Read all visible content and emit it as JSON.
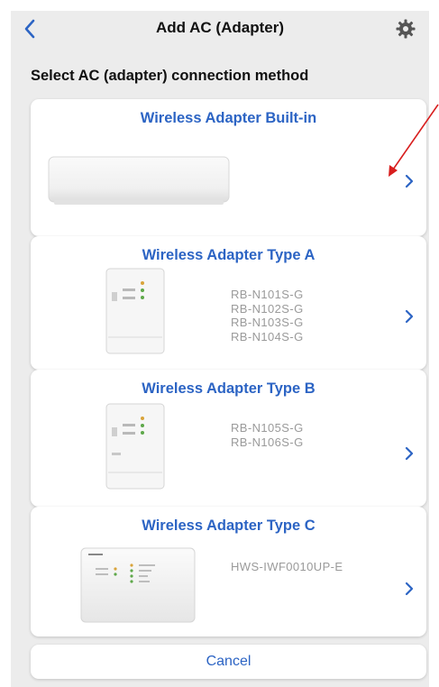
{
  "colors": {
    "accent": "#2c64c4",
    "background": "#ececec",
    "card": "#ffffff",
    "model_text": "#9a9a9a",
    "annotation_arrow": "#d81e1e"
  },
  "navbar": {
    "back_icon": "chevron-left-icon",
    "title": "Add AC (Adapter)",
    "settings_icon": "gear-icon"
  },
  "main": {
    "subtitle": "Select AC (adapter) connection method",
    "options": [
      {
        "title": "Wireless Adapter Built-in",
        "models": [],
        "image": "ac-indoor-unit"
      },
      {
        "title": "Wireless Adapter Type A",
        "models": [
          "RB-N101S-G",
          "RB-N102S-G",
          "RB-N103S-G",
          "RB-N104S-G"
        ],
        "image": "adapter-device"
      },
      {
        "title": "Wireless Adapter Type B",
        "models": [
          "RB-N105S-G",
          "RB-N106S-G"
        ],
        "image": "adapter-device"
      },
      {
        "title": "Wireless Adapter Type C",
        "models": [
          "HWS-IWF0010UP-E"
        ],
        "image": "adapter-box"
      }
    ],
    "cancel_label": "Cancel"
  }
}
